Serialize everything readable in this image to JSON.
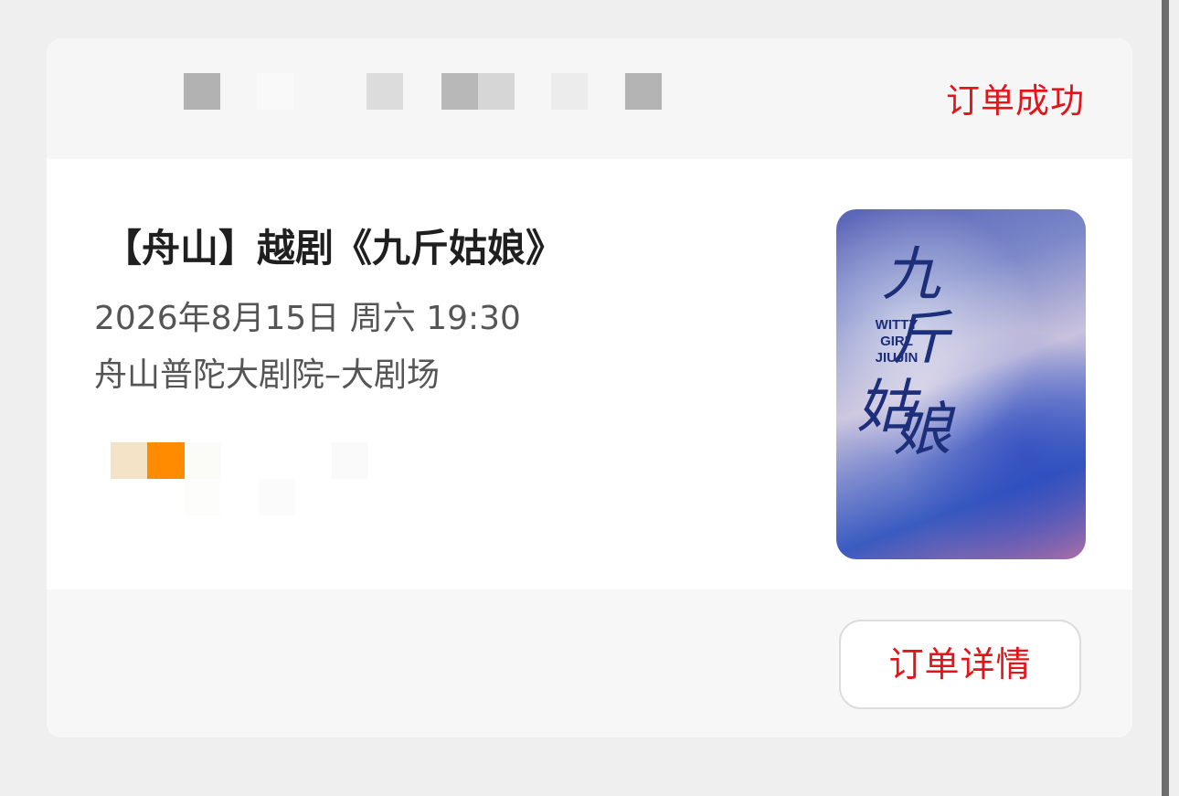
{
  "order": {
    "status_text": "订单成功",
    "order_number_masked": true
  },
  "show": {
    "title": "【舟山】越剧《九斤姑娘》",
    "datetime": "2026年8月15日 周六 19:30",
    "venue": "舟山普陀大剧院–大剧场",
    "poster": {
      "title_glyphs": [
        "九",
        "斤",
        "姑",
        "娘"
      ],
      "english_title": "WITTY GIRL JIUJIN"
    }
  },
  "actions": {
    "detail_label": "订单详情"
  },
  "colors": {
    "accent_red": "#e0161a",
    "card_bg": "#ffffff",
    "page_bg": "#efefef",
    "tag_orange": "#ff8c00",
    "tag_beige": "#f5e3c8"
  }
}
